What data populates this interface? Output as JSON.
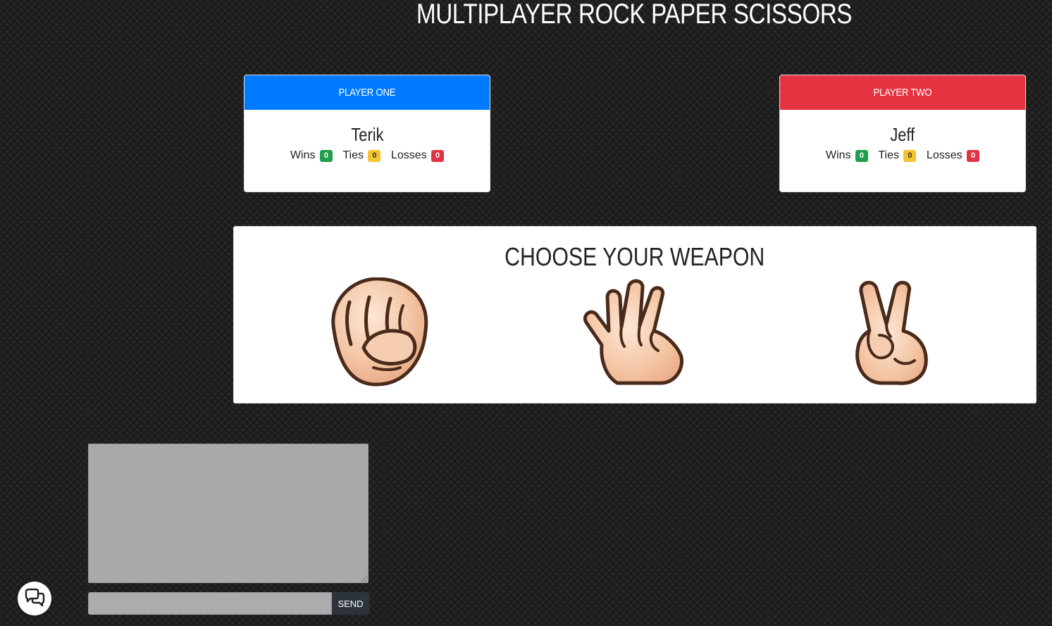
{
  "page": {
    "title": "MULTIPLAYER ROCK PAPER SCISSORS"
  },
  "players": [
    {
      "header": "PLAYER ONE",
      "name": "Terik",
      "color": "#007bff",
      "wins_label": "Wins",
      "wins": "0",
      "ties_label": "Ties",
      "ties": "0",
      "losses_label": "Losses",
      "losses": "0"
    },
    {
      "header": "PLAYER TWO",
      "name": "Jeff",
      "color": "#e53341",
      "wins_label": "Wins",
      "wins": "0",
      "ties_label": "Ties",
      "ties": "0",
      "losses_label": "Losses",
      "losses": "0"
    }
  ],
  "weapons": {
    "title": "CHOOSE YOUR WEAPON",
    "options": [
      {
        "icon": "rock-fist-icon"
      },
      {
        "icon": "paper-hand-icon"
      },
      {
        "icon": "scissors-hand-icon"
      }
    ]
  },
  "chat": {
    "log": "",
    "input_value": "",
    "send_label": "SEND"
  },
  "widget": {
    "icon": "chat-bubbles-icon"
  },
  "colors": {
    "badge_wins": "#1f9e4b",
    "badge_ties": "#f4c430",
    "badge_losses": "#e03444",
    "skin": "#f3c7a6",
    "outline": "#4a2a1a"
  }
}
